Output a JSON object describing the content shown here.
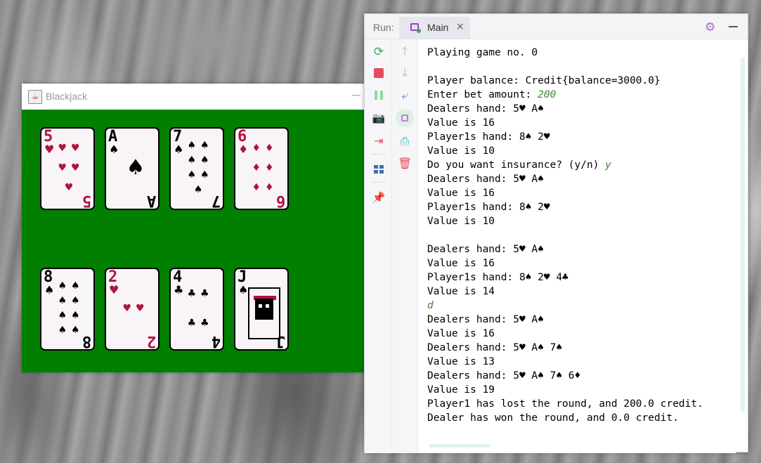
{
  "blackjack_window": {
    "title": "Blackjack",
    "dealer_cards": [
      {
        "rank": "5",
        "suit": "♥",
        "color": "red"
      },
      {
        "rank": "A",
        "suit": "♠",
        "color": "black"
      },
      {
        "rank": "7",
        "suit": "♠",
        "color": "black"
      },
      {
        "rank": "6",
        "suit": "♦",
        "color": "red"
      }
    ],
    "player_cards": [
      {
        "rank": "8",
        "suit": "♠",
        "color": "black"
      },
      {
        "rank": "2",
        "suit": "♥",
        "color": "red"
      },
      {
        "rank": "4",
        "suit": "♣",
        "color": "black"
      },
      {
        "rank": "J",
        "suit": "♠",
        "color": "black"
      }
    ],
    "felt_color": "#007f00"
  },
  "run_window": {
    "run_label": "Run:",
    "tab_label": "Main",
    "tab_close": "×",
    "icons": {
      "rerun": "rerun-icon",
      "stop": "stop-icon",
      "pause": "pause-icon",
      "screenshot": "camera-icon",
      "exit": "exit-icon",
      "layout": "layout-icon",
      "pin": "pin-icon",
      "up": "arrow-up-icon",
      "down": "arrow-down-icon",
      "wrap": "soft-wrap-icon",
      "scroll_end": "scroll-to-end-icon",
      "print": "print-icon",
      "delete": "trash-icon",
      "settings": "gear-icon",
      "hide": "minimize-icon"
    },
    "console_lines": [
      {
        "text": "Playing game no. 0",
        "input": ""
      },
      {
        "text": "",
        "input": ""
      },
      {
        "text": "Player balance: Credit{balance=3000.0}",
        "input": ""
      },
      {
        "text": "Enter bet amount: ",
        "input": "200"
      },
      {
        "text": "Dealers hand: 5♥ A♠",
        "input": ""
      },
      {
        "text": "Value is 16",
        "input": ""
      },
      {
        "text": "Player1s hand: 8♠ 2♥",
        "input": ""
      },
      {
        "text": "Value is 10",
        "input": ""
      },
      {
        "text": "Do you want insurance? (y/n) ",
        "input": "y"
      },
      {
        "text": "Dealers hand: 5♥ A♠",
        "input": ""
      },
      {
        "text": "Value is 16",
        "input": ""
      },
      {
        "text": "Player1s hand: 8♠ 2♥",
        "input": ""
      },
      {
        "text": "Value is 10",
        "input": ""
      },
      {
        "text": "",
        "input": ""
      },
      {
        "text": "Dealers hand: 5♥ A♠",
        "input": ""
      },
      {
        "text": "Value is 16",
        "input": ""
      },
      {
        "text": "Player1s hand: 8♠ 2♥ 4♣",
        "input": ""
      },
      {
        "text": "Value is 14",
        "input": ""
      },
      {
        "text": "",
        "input": "d"
      },
      {
        "text": "Dealers hand: 5♥ A♠",
        "input": ""
      },
      {
        "text": "Value is 16",
        "input": ""
      },
      {
        "text": "Dealers hand: 5♥ A♠ 7♠",
        "input": ""
      },
      {
        "text": "Value is 13",
        "input": ""
      },
      {
        "text": "Dealers hand: 5♥ A♠ 7♠ 6♦",
        "input": ""
      },
      {
        "text": "Value is 19",
        "input": ""
      },
      {
        "text": "Player1 has lost the round, and 200.0 credit.",
        "input": ""
      },
      {
        "text": "Dealer has won the round, and 0.0 credit.",
        "input": ""
      }
    ],
    "colors": {
      "user_input": "#3a8a2e",
      "accent_purple": "#a56ccf",
      "stop_red": "#e8495f"
    }
  }
}
